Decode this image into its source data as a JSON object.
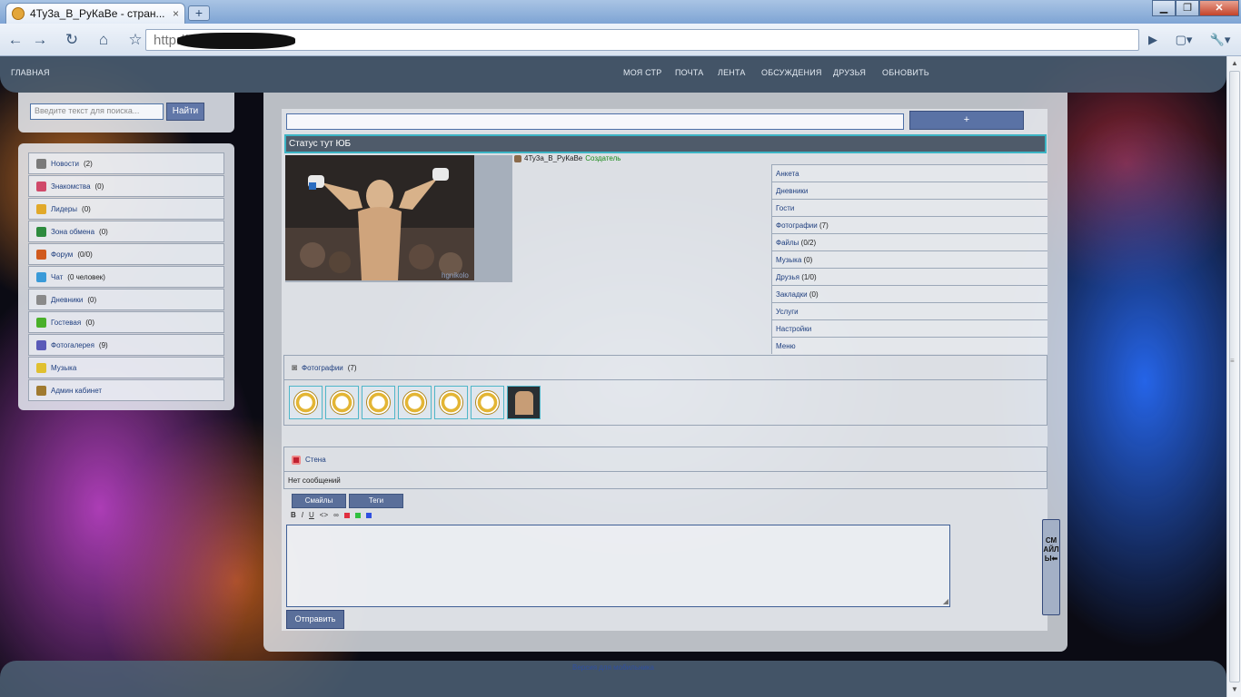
{
  "browser": {
    "tab_title": "4Ту3а_В_РуКаВе - стран...",
    "tab_close": "×",
    "new_tab": "+",
    "window_buttons": {
      "minimize": "▁",
      "maximize": "❐",
      "close": "✕"
    },
    "url": "http://...../info.php?",
    "toolbar_icons": {
      "back": "←",
      "forward": "→",
      "reload": "↻",
      "home": "⌂",
      "star": "☆",
      "go": "▶",
      "page": "▢▾",
      "wrench": "🔧▾"
    }
  },
  "nav": {
    "home": "ГЛАВНАЯ",
    "items": [
      "МОЯ СТР",
      "ПОЧТА",
      "ЛЕНТА",
      "ОБСУЖДЕНИЯ",
      "ДРУЗЬЯ",
      "ОБНОВИТЬ"
    ]
  },
  "search": {
    "placeholder": "Введите текст для поиска...",
    "button": "Найти"
  },
  "menu": [
    {
      "label": "Новости",
      "count": "(2)",
      "color": "#7a7a7a"
    },
    {
      "label": "Знакомства",
      "count": "(0)",
      "color": "#d04a6a"
    },
    {
      "label": "Лидеры",
      "count": "(0)",
      "color": "#e1a92a"
    },
    {
      "label": "Зона обмена",
      "count": "(0)",
      "color": "#2e8b3e"
    },
    {
      "label": "Форум",
      "count": "(0/0)",
      "color": "#d05a1e"
    },
    {
      "label": "Чат",
      "count": "(0 человек)",
      "color": "#3a9ad8"
    },
    {
      "label": "Дневники",
      "count": "(0)",
      "color": "#8a8a8a"
    },
    {
      "label": "Гостевая",
      "count": "(0)",
      "color": "#4ab02a"
    },
    {
      "label": "Фотогалерея",
      "count": "(9)",
      "color": "#5a5ab8"
    },
    {
      "label": "Музыка",
      "count": "",
      "color": "#e0c030"
    },
    {
      "label": "Админ кабинет",
      "count": "",
      "color": "#a07a30"
    }
  ],
  "profile": {
    "plus_button": "+",
    "status": "Статус тут ЮБ",
    "photo_watermark": "hgnikolo",
    "username": "4Ту3а_В_РуКаВе",
    "role": "Создатель",
    "links": [
      {
        "label": "Анкета",
        "count": ""
      },
      {
        "label": "Дневники",
        "count": ""
      },
      {
        "label": "Гости",
        "count": ""
      },
      {
        "label": "Фотографии",
        "count": "(7)"
      },
      {
        "label": "Файлы",
        "count": "(0/2)"
      },
      {
        "label": "Музыка",
        "count": "(0)"
      },
      {
        "label": "Друзья",
        "count": "(1/0)"
      },
      {
        "label": "Закладки",
        "count": "(0)"
      },
      {
        "label": "Услуги",
        "count": ""
      },
      {
        "label": "Настройки",
        "count": ""
      },
      {
        "label": "Меню",
        "count": ""
      }
    ]
  },
  "photos": {
    "label": "Фотографии",
    "count": "(7)"
  },
  "wall": {
    "label": "Стена",
    "empty": "Нет сообщений",
    "tabs": [
      "Смайлы",
      "Теги"
    ],
    "format": [
      "B",
      "I",
      "U",
      "<>",
      "∞"
    ],
    "colors": [
      "#e03040",
      "#30c040",
      "#3050e0"
    ],
    "send": "Отправить",
    "smiles_side": "СМАЙЛЫ⬅"
  },
  "footer": {
    "mobile_link": "Версия для мобильника"
  }
}
